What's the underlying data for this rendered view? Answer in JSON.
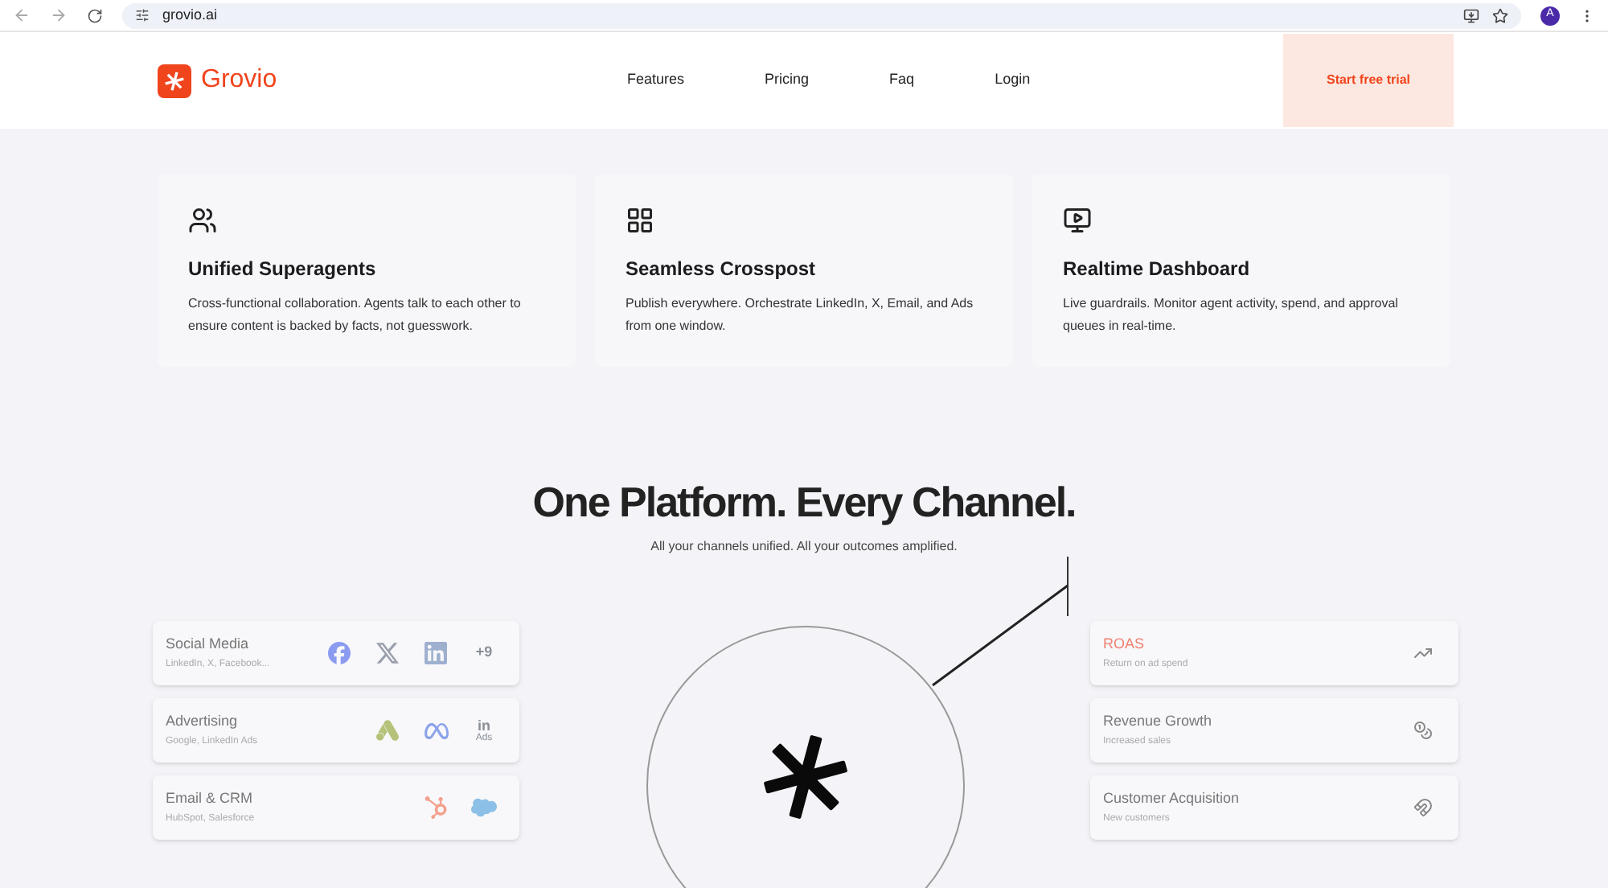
{
  "browser": {
    "url": "grovio.ai",
    "avatar": "A"
  },
  "nav": {
    "brand": "Grovio",
    "links": [
      "Features",
      "Pricing",
      "Faq",
      "Login"
    ],
    "cta": "Start free trial"
  },
  "features": [
    {
      "kind": "users",
      "title": "Unified Superagents",
      "text": "Cross-functional collaboration. Agents talk to each other to ensure content is backed by facts, not guesswork."
    },
    {
      "kind": "widgets",
      "title": "Seamless Crosspost",
      "text": "Publish everywhere. Orchestrate LinkedIn, X, Email, and Ads from one window."
    },
    {
      "kind": "monitor",
      "title": "Realtime Dashboard",
      "text": "Live guardrails. Monitor agent activity, spend, and approval queues in real-time."
    }
  ],
  "section": {
    "title": "One Platform. Every Channel.",
    "subtitle": "All your channels unified. All your outcomes amplified."
  },
  "channels": [
    {
      "title": "Social Media",
      "subtitle": "LinkedIn, X, Facebook...",
      "icons": [
        {
          "kind": "facebook"
        },
        {
          "kind": "x"
        },
        {
          "kind": "linkedin"
        },
        {
          "kind": "text",
          "label": "+9"
        }
      ]
    },
    {
      "title": "Advertising",
      "subtitle": "Google, LinkedIn Ads",
      "icons": [
        {
          "kind": "googleads"
        },
        {
          "kind": "meta"
        },
        {
          "kind": "stack",
          "label": "in",
          "sub": "Ads"
        }
      ]
    },
    {
      "title": "Email & CRM",
      "subtitle": "HubSpot, Salesforce",
      "icons": [
        {
          "kind": "hubspot"
        },
        {
          "kind": "salesforce"
        }
      ]
    }
  ],
  "outcomes": [
    {
      "title": "ROAS",
      "subtitle": "Return on ad spend",
      "highlighted": true,
      "kind": "trend"
    },
    {
      "title": "Revenue Growth",
      "subtitle": "Increased sales",
      "highlighted": false,
      "kind": "coins"
    },
    {
      "title": "Customer Acquisition",
      "subtitle": "New customers",
      "highlighted": false,
      "kind": "magnet"
    }
  ]
}
